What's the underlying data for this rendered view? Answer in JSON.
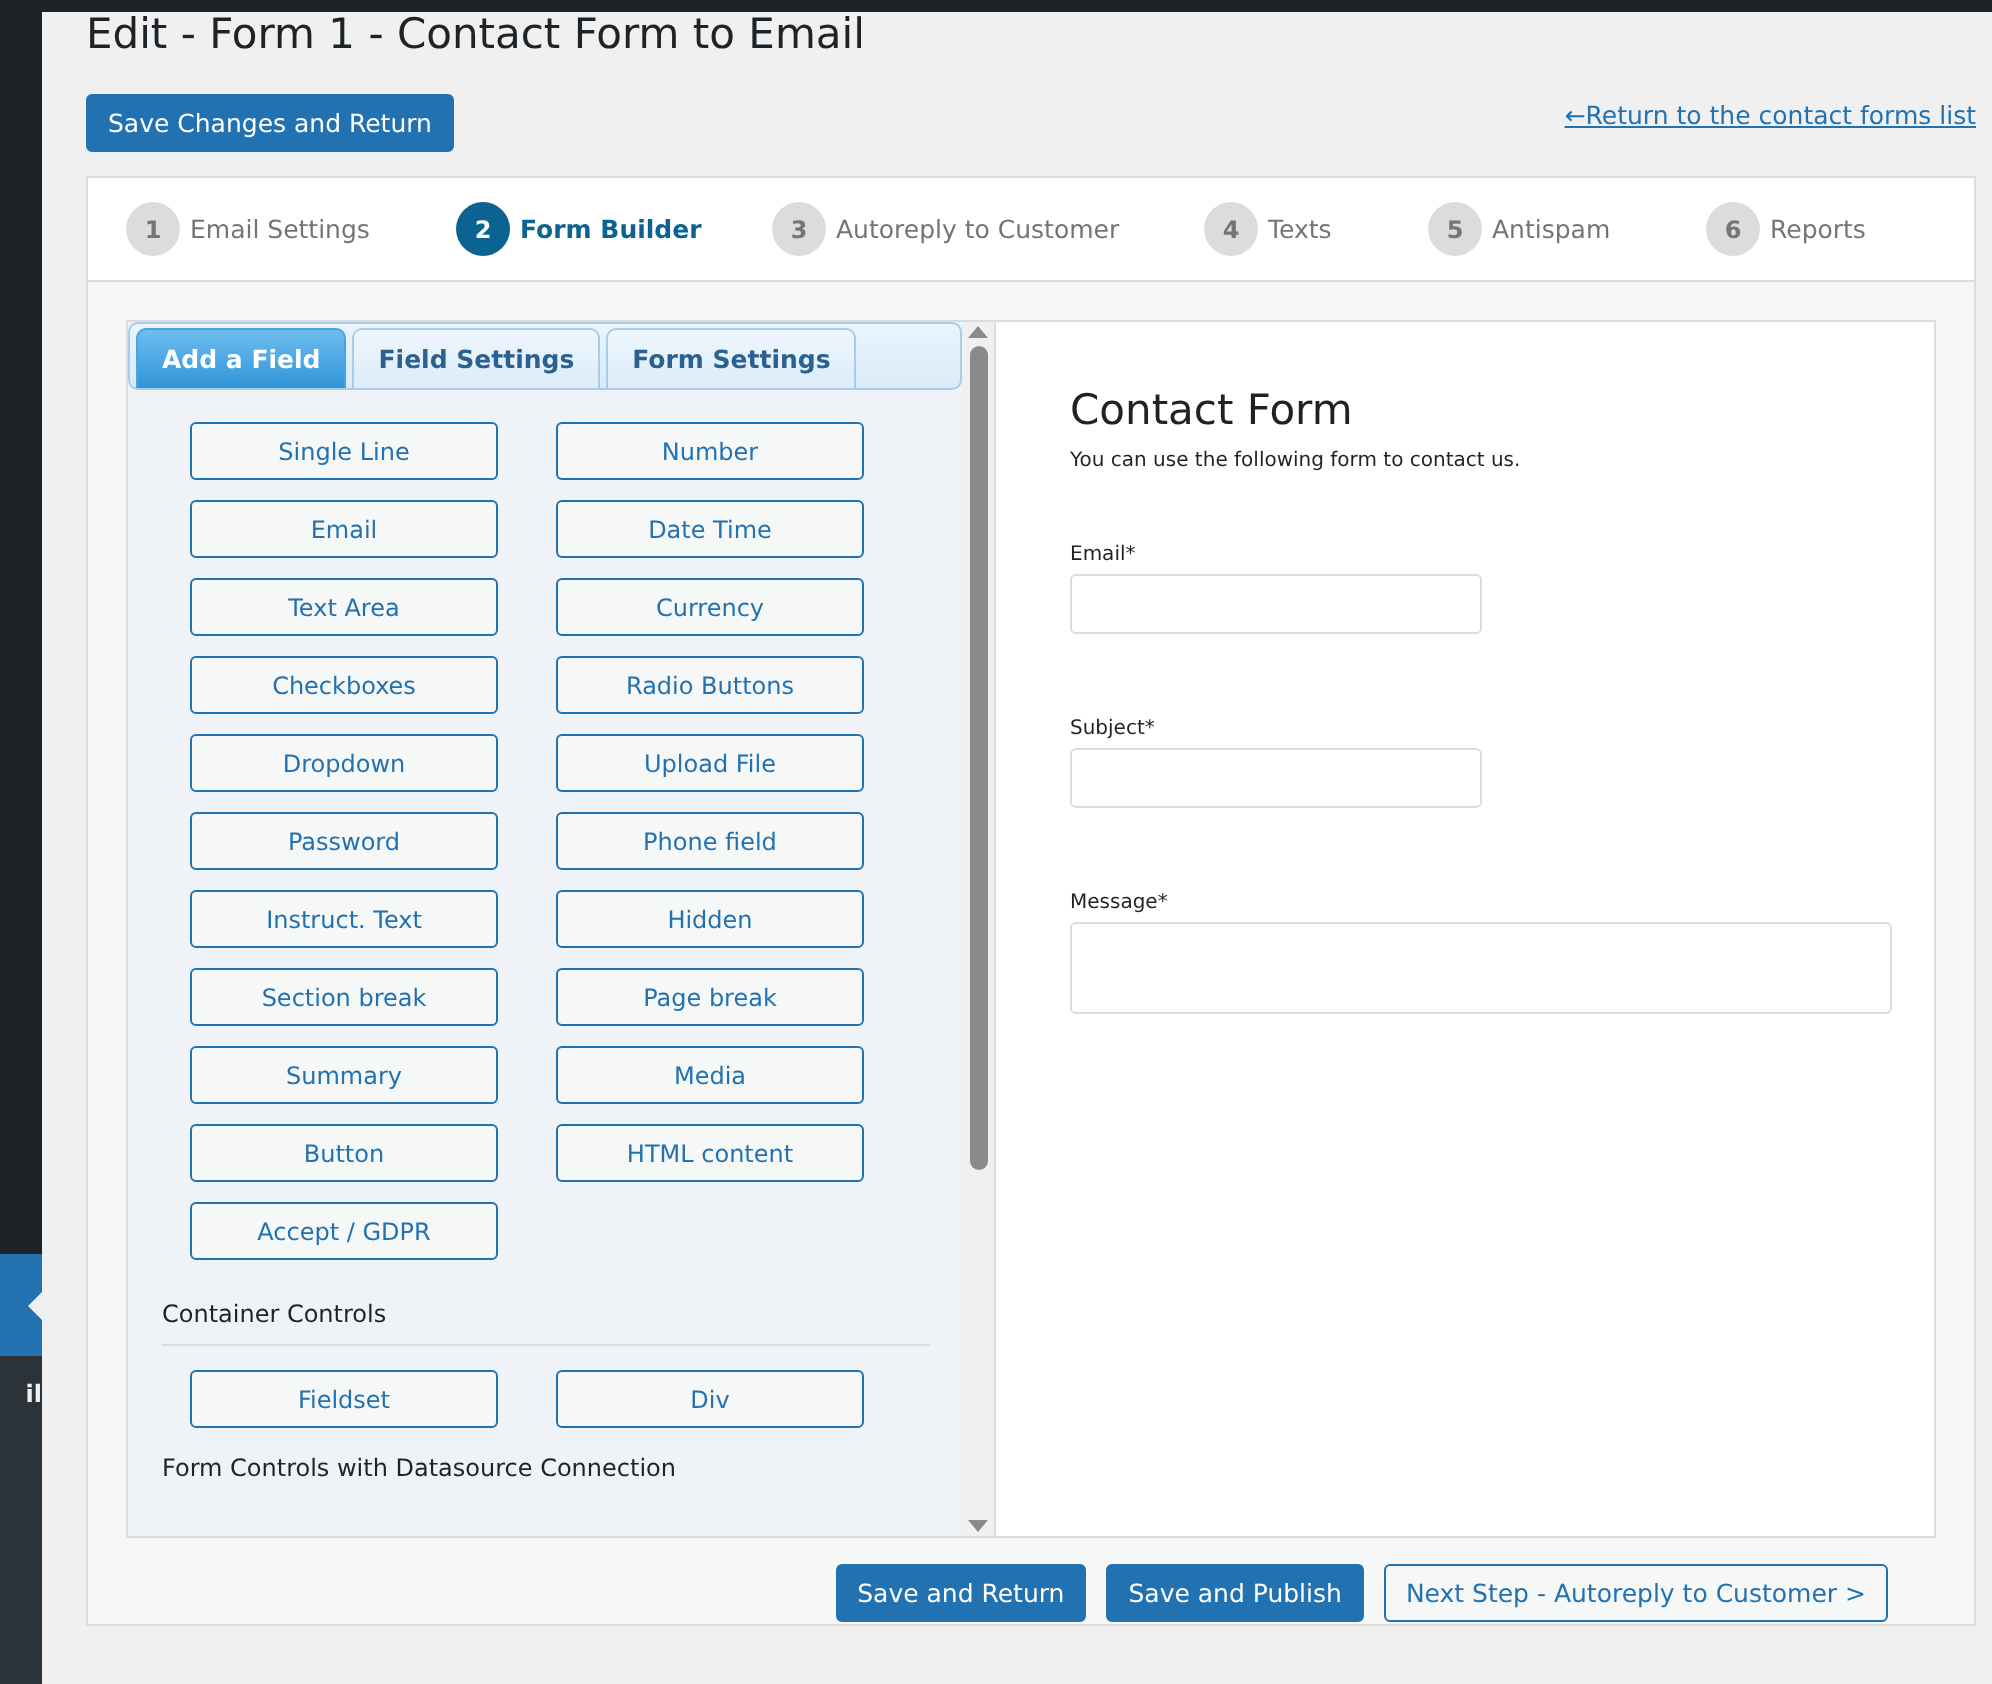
{
  "sidebar": {
    "menu_text": "il"
  },
  "page_title": "Edit - Form 1 - Contact Form to Email",
  "save_button": "Save Changes and Return",
  "return_link": "←Return to the contact forms list",
  "steps": [
    {
      "number": "1",
      "label": "Email Settings",
      "selected": false
    },
    {
      "number": "2",
      "label": "Form Builder",
      "selected": true
    },
    {
      "number": "3",
      "label": "Autoreply to Customer",
      "selected": false
    },
    {
      "number": "4",
      "label": "Texts",
      "selected": false
    },
    {
      "number": "5",
      "label": "Antispam",
      "selected": false
    },
    {
      "number": "6",
      "label": "Reports",
      "selected": false
    }
  ],
  "builder_tabs": [
    {
      "label": "Add a Field",
      "selected": true
    },
    {
      "label": "Field Settings",
      "selected": false
    },
    {
      "label": "Form Settings",
      "selected": false
    }
  ],
  "field_buttons": [
    "Single Line",
    "Number",
    "Email",
    "Date Time",
    "Text Area",
    "Currency",
    "Checkboxes",
    "Radio Buttons",
    "Dropdown",
    "Upload File",
    "Password",
    "Phone field",
    "Instruct. Text",
    "Hidden",
    "Section break",
    "Page break",
    "Summary",
    "Media",
    "Button",
    "HTML content",
    "Accept / GDPR"
  ],
  "container_controls": {
    "heading": "Container Controls",
    "buttons": [
      "Fieldset",
      "Div"
    ]
  },
  "datasource_heading": "Form Controls with Datasource Connection",
  "preview": {
    "title": "Contact Form",
    "description": "You can use the following form to contact us.",
    "fields": [
      {
        "label": "Email*",
        "kind": "input"
      },
      {
        "label": "Subject*",
        "kind": "input"
      },
      {
        "label": "Message*",
        "kind": "textarea"
      }
    ]
  },
  "bottom_buttons": [
    {
      "label": "Save and Return",
      "kind": "primary"
    },
    {
      "label": "Save and Publish",
      "kind": "primary"
    },
    {
      "label": "Next Step - Autoreply to Customer >",
      "kind": "secondary"
    }
  ]
}
